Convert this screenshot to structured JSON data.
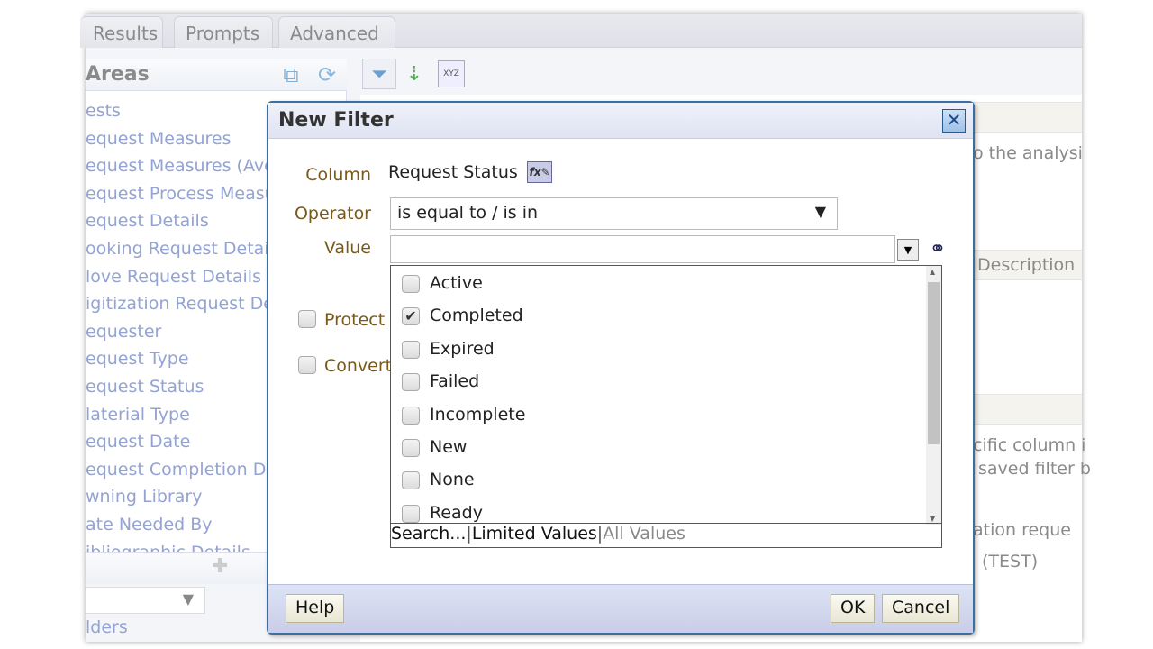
{
  "tabs": [
    {
      "label": "Results"
    },
    {
      "label": "Prompts"
    },
    {
      "label": "Advanced"
    }
  ],
  "subject_areas": {
    "title": "Areas",
    "items": [
      "ests",
      "equest Measures",
      "equest Measures (Ave",
      "equest Process Measu",
      "equest Details",
      "ooking Request Detai",
      "love Request Details",
      "igitization Request De",
      "equester",
      "equest Type",
      "equest Status",
      "laterial Type",
      "equest Date",
      "equest Completion Da",
      "wning Library",
      "ate Needed By",
      "ibliographic Details"
    ],
    "folders_label": "lders"
  },
  "right_pane": {
    "text1": "o the analysi",
    "col_header": "Description",
    "text2": "cific column i",
    "text3": "saved filter b",
    "text4": "ation reque",
    "text5": "(TEST)"
  },
  "dialog": {
    "title": "New Filter",
    "column_label": "Column",
    "column_value": "Request Status",
    "operator_label": "Operator",
    "operator_value": "is equal to / is in",
    "value_label": "Value",
    "value_input": "",
    "protect_label": "Protect",
    "convert_label": "Convert",
    "options": [
      {
        "label": "Active",
        "checked": false
      },
      {
        "label": "Completed",
        "checked": true
      },
      {
        "label": "Expired",
        "checked": false
      },
      {
        "label": "Failed",
        "checked": false
      },
      {
        "label": "Incomplete",
        "checked": false
      },
      {
        "label": "New",
        "checked": false
      },
      {
        "label": "None",
        "checked": false
      },
      {
        "label": "Ready",
        "checked": false
      }
    ],
    "footer_links": {
      "search": "Search...",
      "limited": "Limited Values",
      "all": "All Values"
    },
    "help": "Help",
    "ok": "OK",
    "cancel": "Cancel"
  }
}
